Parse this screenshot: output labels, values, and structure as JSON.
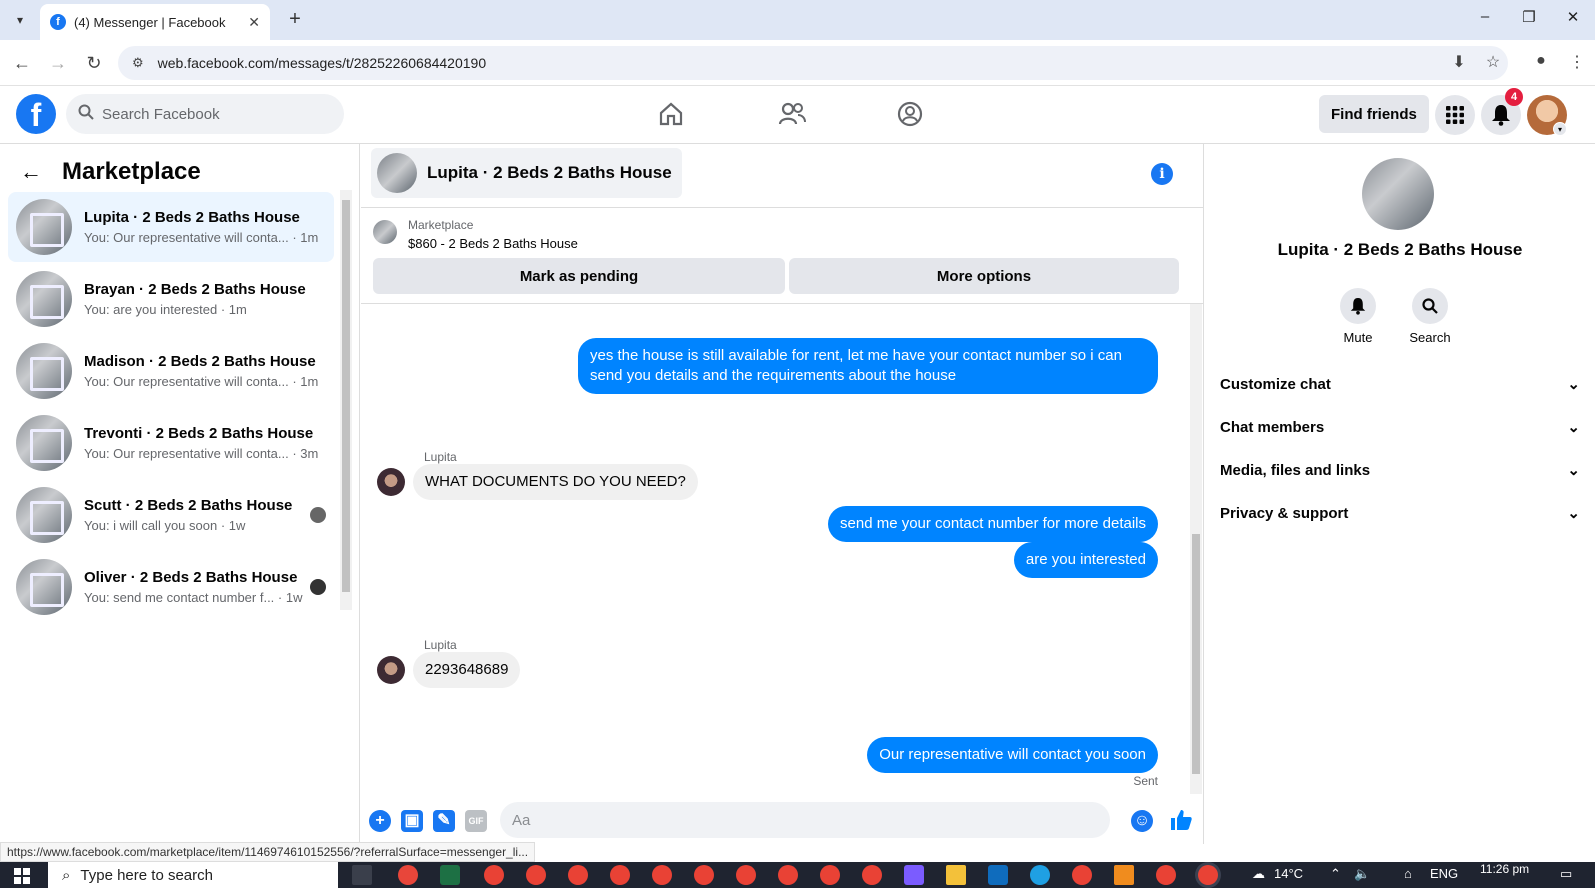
{
  "browser": {
    "tab_title": "(4) Messenger | Facebook",
    "favicon": "f",
    "url": "web.facebook.com/messages/t/28252260684420190",
    "status_url": "https://www.facebook.com/marketplace/item/1146974610152556/?referralSurface=messenger_li..."
  },
  "header": {
    "search_placeholder": "Search Facebook",
    "find_friends": "Find friends",
    "notification_count": "4"
  },
  "left": {
    "title": "Marketplace",
    "conversations": [
      {
        "name": "Lupita · 2 Beds 2 Baths House",
        "preview": "You: Our representative will conta... · 1m",
        "active": true
      },
      {
        "name": "Brayan · 2 Beds 2 Baths House",
        "preview": "You: are you interested · 1m"
      },
      {
        "name": "Madison · 2 Beds 2 Baths House",
        "preview": "You: Our representative will conta... · 1m"
      },
      {
        "name": "Trevonti · 2 Beds 2 Baths House",
        "preview": "You: Our representative will conta... · 3m"
      },
      {
        "name": "Scutt · 2 Beds 2 Baths House",
        "preview": "You: i will call you soon · 1w"
      },
      {
        "name": "Oliver · 2 Beds 2 Baths House",
        "preview": "You: send me contact number f... · 1w"
      }
    ]
  },
  "chat": {
    "title": "Lupita · 2 Beds 2 Baths House",
    "listing_source": "Marketplace",
    "listing_title": "$860 - 2 Beds 2 Baths House",
    "mark_pending": "Mark as pending",
    "more_options": "More options",
    "messages": {
      "out1": "yes the house is still available for rent, let me have your contact number so i can send you details and the requirements about the house",
      "sender1": "Lupita",
      "in1": "WHAT DOCUMENTS DO YOU NEED?",
      "out2": "send me your contact number for more details",
      "out3": "are you interested",
      "sender2": "Lupita",
      "in2": "2293648689",
      "out4": "Our representative will contact you soon",
      "sent": "Sent"
    },
    "composer_placeholder": "Aa"
  },
  "right": {
    "name": "Lupita · 2 Beds 2 Baths House",
    "mute": "Mute",
    "search": "Search",
    "sections": [
      "Customize chat",
      "Chat members",
      "Media, files and links",
      "Privacy & support"
    ]
  },
  "taskbar": {
    "search": "Type here to search",
    "temp": "14°C",
    "lang": "ENG",
    "time": "11:26 pm"
  },
  "colors": {
    "brand": "#1877f2",
    "bubble_out": "#0084ff",
    "badge": "#e41e3f"
  }
}
